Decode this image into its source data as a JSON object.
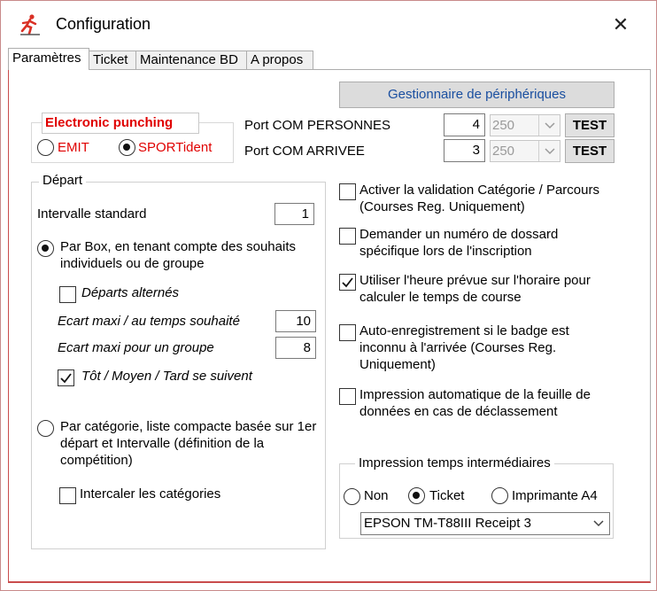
{
  "window": {
    "title": "Configuration",
    "close_glyph": "✕"
  },
  "icons": {
    "app": "runner-app-icon",
    "close": "close-icon",
    "dropdown": "chevron-down-icon",
    "checkmark": "checkmark-icon"
  },
  "colors": {
    "accent_blue": "#1a4fa0",
    "punching_red": "#e00000",
    "app_icon_red": "#d93025"
  },
  "tabs": [
    {
      "label": "Paramètres",
      "active": true
    },
    {
      "label": "Ticket",
      "active": false
    },
    {
      "label": "Maintenance BD",
      "active": false
    },
    {
      "label": "A propos",
      "active": false
    }
  ],
  "device_manager": {
    "label": "Gestionnaire de périphériques"
  },
  "punching": {
    "title": "Electronic punching",
    "options": [
      {
        "label": "EMIT",
        "checked": false
      },
      {
        "label": "SPORTident",
        "checked": true
      }
    ]
  },
  "ports": [
    {
      "label": "Port COM PERSONNES",
      "value": "4",
      "speed": "250",
      "test_label": "TEST"
    },
    {
      "label": "Port COM ARRIVEE",
      "value": "3",
      "speed": "250",
      "test_label": "TEST"
    }
  ],
  "depart": {
    "legend": "Départ",
    "interval_label": "Intervalle standard",
    "interval_value": "1",
    "by_box": {
      "label": "Par Box, en tenant compte des souhaits individuels ou de groupe",
      "checked": true
    },
    "alternated": {
      "label": "Départs alternés",
      "checked": false
    },
    "max_gap_wish_label": "Ecart maxi / au temps souhaité",
    "max_gap_wish_value": "10",
    "max_gap_group_label": "Ecart maxi pour un groupe",
    "max_gap_group_value": "8",
    "early_mid_late": {
      "label": "Tôt / Moyen / Tard se suivent",
      "checked": true
    },
    "by_category": {
      "label": "Par catégorie, liste compacte basée sur 1er départ et Intervalle (définition de la compétition)",
      "checked": false
    },
    "intercalate": {
      "label": "Intercaler les catégories",
      "checked": false
    }
  },
  "options": [
    {
      "label": "Activer la validation Catégorie / Parcours  (Courses Reg. Uniquement)",
      "checked": false
    },
    {
      "label": "Demander un numéro de dossard spécifique lors de l'inscription",
      "checked": false
    },
    {
      "label": "Utiliser l'heure prévue sur l'horaire pour calculer le temps de course",
      "checked": true
    },
    {
      "label": "Auto-enregistrement si le badge est inconnu à l'arrivée (Courses Reg. Uniquement)",
      "checked": false
    },
    {
      "label": "Impression automatique de la feuille de données en cas de déclassement",
      "checked": false
    }
  ],
  "split_print": {
    "legend": "Impression temps intermédiaires",
    "options": [
      {
        "label": "Non",
        "checked": false
      },
      {
        "label": "Ticket",
        "checked": true
      },
      {
        "label": "Imprimante A4",
        "checked": false
      }
    ],
    "printer": "EPSON TM-T88III Receipt 3"
  }
}
